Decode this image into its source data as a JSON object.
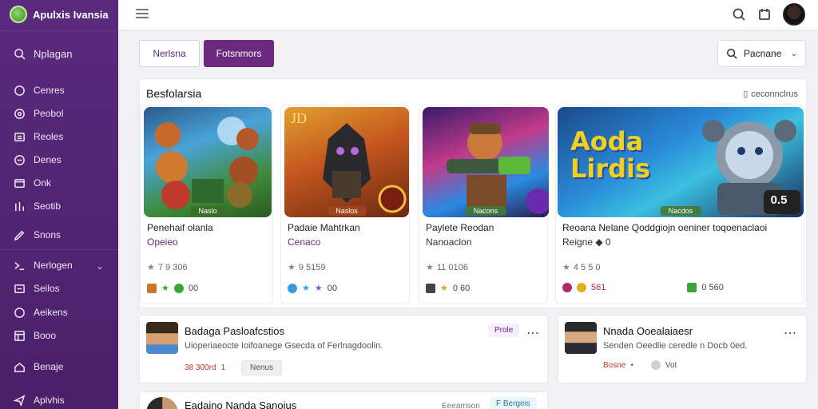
{
  "app": {
    "title": "Apulxis Ivansia"
  },
  "sidebar": {
    "search_label": "Nplagan",
    "items": [
      {
        "label": "Cenres",
        "icon": "circle-icon"
      },
      {
        "label": "Peobol",
        "icon": "target-icon"
      },
      {
        "label": "Reoles",
        "icon": "list-icon"
      },
      {
        "label": "Denes",
        "icon": "calendar-icon"
      },
      {
        "label": "Onk",
        "icon": "link-icon"
      },
      {
        "label": "Seotib",
        "icon": "chart-icon"
      },
      {
        "label": "Snons",
        "icon": "pen-icon"
      },
      {
        "label": "Nerlogen",
        "icon": "group-icon"
      },
      {
        "label": "Seilos",
        "icon": "flag-icon"
      },
      {
        "label": "Aeikens",
        "icon": "ring-icon"
      },
      {
        "label": "Booo",
        "icon": "grid-icon"
      },
      {
        "label": "Benaje",
        "icon": "home-icon"
      },
      {
        "label": "Aplvhis",
        "icon": "paper-plane-icon"
      }
    ]
  },
  "filters": {
    "tab_1": "Nerlsna",
    "tab_2": "Fotsnmors",
    "sort_label": "Pacnane"
  },
  "featured": {
    "title": "Besfolarsia",
    "link": "ceconnclrus",
    "cards": [
      {
        "name": "Penehaif olanla",
        "sub": "Opeieo",
        "badge": "Naslo",
        "rating": "7 9 306",
        "stat": "00"
      },
      {
        "name": "Padaie Mahtrkan",
        "sub": "Cenaco",
        "badge": "Naslos",
        "rating": "9 5159",
        "stat": "00"
      },
      {
        "name": "Paylete Reodan",
        "sub": "Nanoaclon",
        "badge": "Nacons",
        "rating": "11 0106",
        "stat": "0 60"
      },
      {
        "name": "Reoana Nelane Qoddgiojn oeniner toqoenaclaoi",
        "sub": "Reigne ◆ 0",
        "badge": "Nacdos",
        "rating": "4 5 5 0",
        "stat_1": "561",
        "stat_2": "0 560",
        "overlay": "Aoda Lirdis",
        "timer": "0.5"
      }
    ]
  },
  "posts": [
    {
      "title": "Badaga Pasloafcstios",
      "desc": "Uioperiaeocte Ioifoanege Gsecda of Ferlnagdoolin.",
      "meta": "38 300rd",
      "meta_num": "1",
      "pill": "Nenus",
      "badge": "Prole"
    },
    {
      "title": "Nnada Ooealaiaesr",
      "desc": "Senden Oeedlie ceredle n Docb 0ed.",
      "meta": "Bosne",
      "meta_sep": "•",
      "pill": "Vot"
    },
    {
      "title": "Eadaino Nanda Sanoius",
      "badge_1": "Eeeamson",
      "badge_2": "F Bergeis"
    }
  ]
}
